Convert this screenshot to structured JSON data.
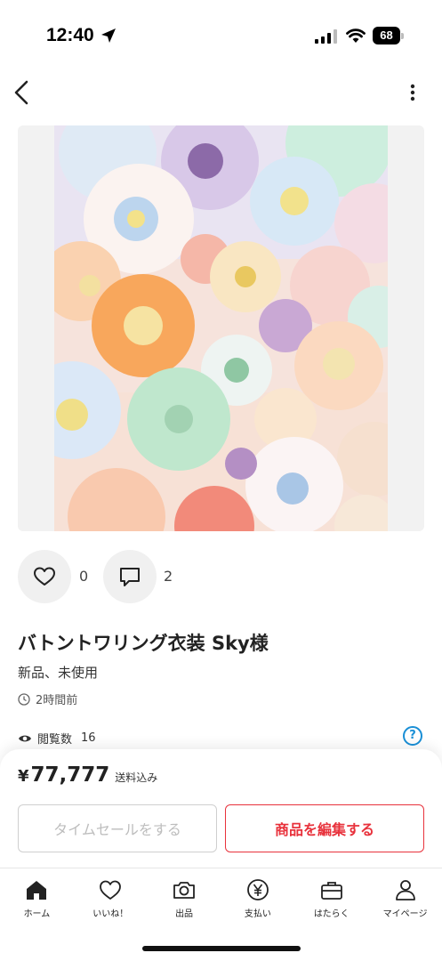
{
  "status_bar": {
    "time": "12:40",
    "battery": "68",
    "icons": [
      "location-arrow-icon",
      "signal-icon",
      "wifi-icon",
      "battery-icon"
    ]
  },
  "nav": {
    "icons": [
      "back-chevron-icon",
      "more-vertical-icon"
    ]
  },
  "product": {
    "image_description_icon": "paper-flowers-photo",
    "likes": "0",
    "comments": "2",
    "title": "バトントワリング衣装 Sky様",
    "condition": "新品、未使用",
    "posted": "2時間前",
    "views_label": "閲覧数",
    "views": "16",
    "help": "?"
  },
  "purchase": {
    "currency": "¥",
    "price": "77,777",
    "shipping_note": "送料込み",
    "timesale_label": "タイムセールをする",
    "edit_label": "商品を編集する",
    "colors": {
      "accent": "#e8323c",
      "help": "#1a8fd6",
      "disabled": "#bdbdbd"
    }
  },
  "tabs": [
    {
      "label": "ホーム",
      "icon": "home-icon"
    },
    {
      "label": "いいね！",
      "icon": "heart-icon"
    },
    {
      "label": "出品",
      "icon": "camera-icon"
    },
    {
      "label": "支払い",
      "icon": "yen-circle-icon"
    },
    {
      "label": "はたらく",
      "icon": "briefcase-icon"
    },
    {
      "label": "マイページ",
      "icon": "person-icon"
    }
  ]
}
